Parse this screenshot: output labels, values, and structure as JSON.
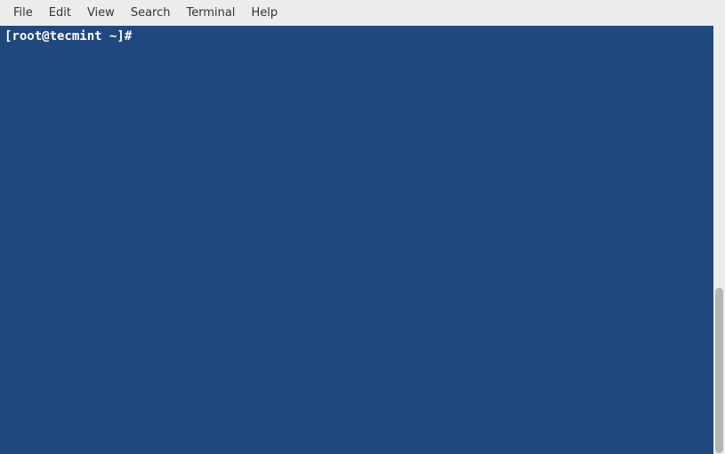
{
  "menubar": {
    "items": [
      {
        "label": "File"
      },
      {
        "label": "Edit"
      },
      {
        "label": "View"
      },
      {
        "label": "Search"
      },
      {
        "label": "Terminal"
      },
      {
        "label": "Help"
      }
    ]
  },
  "terminal": {
    "prompt": "[root@tecmint ~]# ",
    "background_color": "#1f487e",
    "text_color": "#ffffff"
  }
}
